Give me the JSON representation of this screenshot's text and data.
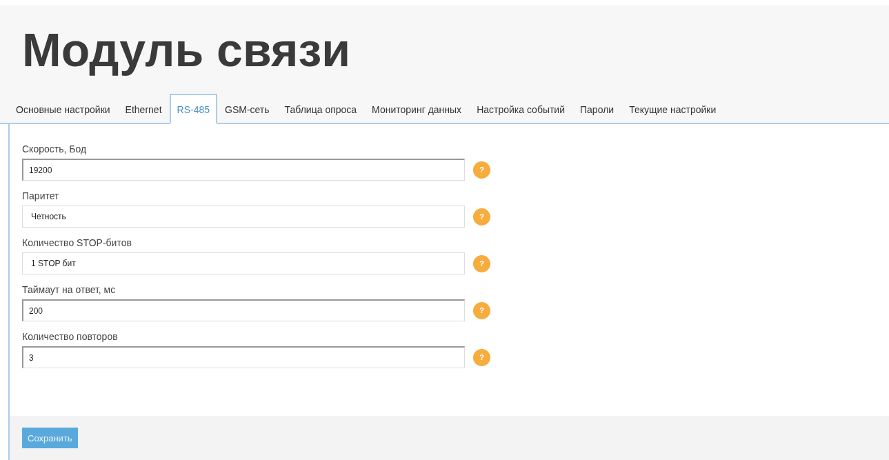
{
  "title": "Модуль связи",
  "tabs": [
    {
      "label": "Основные настройки",
      "selected": false
    },
    {
      "label": "Ethernet",
      "selected": false
    },
    {
      "label": "RS-485",
      "selected": true
    },
    {
      "label": "GSM-сеть",
      "selected": false
    },
    {
      "label": "Таблица опроса",
      "selected": false
    },
    {
      "label": "Мониторинг данных",
      "selected": false
    },
    {
      "label": "Настройка событий",
      "selected": false
    },
    {
      "label": "Пароли",
      "selected": false
    },
    {
      "label": "Текущие настройки",
      "selected": false
    }
  ],
  "fields": [
    {
      "label": "Скорость, Бод",
      "value": "19200",
      "kind": "text",
      "help": "?"
    },
    {
      "label": "Паритет",
      "value": "Четность",
      "kind": "select",
      "help": "?"
    },
    {
      "label": "Количество STOP-битов",
      "value": "1 STOP бит",
      "kind": "select",
      "help": "?"
    },
    {
      "label": "Таймаут на ответ, мс",
      "value": "200",
      "kind": "text",
      "help": "?"
    },
    {
      "label": "Количество повторов",
      "value": "3",
      "kind": "text",
      "help": "?"
    }
  ],
  "save_button": "Сохранить"
}
